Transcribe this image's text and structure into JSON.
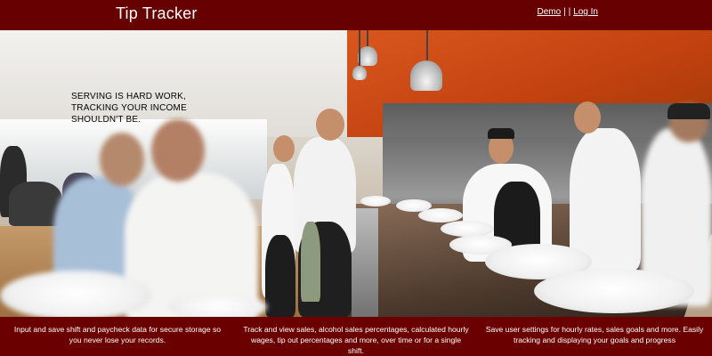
{
  "header": {
    "title": "Tip Tracker",
    "nav": {
      "demo": "Demo",
      "separator": "| |",
      "login": "Log In"
    }
  },
  "hero": {
    "tagline": "SERVING IS HARD WORK, TRACKING YOUR INCOME SHOULDN'T BE."
  },
  "features": [
    {
      "text": "Input and save shift and paycheck data for secure storage so you never lose your records."
    },
    {
      "text": "Track and view sales, alcohol sales percentages, calculated hourly wages, tip out percentages and more, over time or for a single shift."
    },
    {
      "text": "Save user settings for hourly rates, sales goals and more. Easily tracking and displaying your goals and progress"
    }
  ],
  "colors": {
    "brand_dark_red": "#6b0000",
    "text_white": "#ffffff"
  }
}
